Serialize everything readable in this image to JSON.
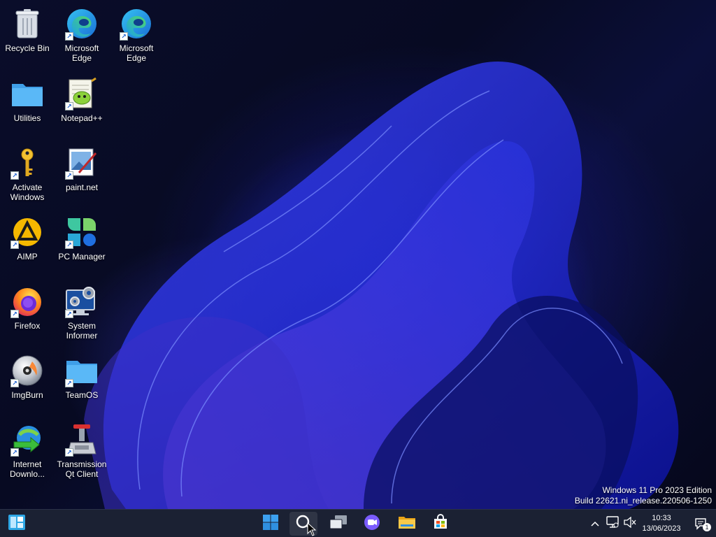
{
  "desktop": {
    "icons": [
      {
        "label": "Recycle Bin",
        "icon": "recycle-bin-icon"
      },
      {
        "label": "Microsoft Edge",
        "icon": "edge-icon"
      },
      {
        "label": "Microsoft Edge",
        "icon": "edge-icon"
      },
      {
        "label": "Utilities",
        "icon": "folder-icon"
      },
      {
        "label": "Notepad++",
        "icon": "notepad-plus-plus-icon"
      },
      {
        "label": "Activate Windows",
        "icon": "key-icon"
      },
      {
        "label": "paint.net",
        "icon": "paint-net-icon"
      },
      {
        "label": "AIMP",
        "icon": "aimp-icon"
      },
      {
        "label": "PC Manager",
        "icon": "pc-manager-icon"
      },
      {
        "label": "Firefox",
        "icon": "firefox-icon"
      },
      {
        "label": "System Informer",
        "icon": "system-informer-icon"
      },
      {
        "label": "ImgBurn",
        "icon": "imgburn-icon"
      },
      {
        "label": "TeamOS",
        "icon": "folder-icon"
      },
      {
        "label": "Internet Downlo...",
        "icon": "internet-download-manager-icon"
      },
      {
        "label": "Transmission Qt Client",
        "icon": "transmission-icon"
      }
    ]
  },
  "watermark": {
    "line1": "Windows 11 Pro 2023 Edition",
    "line2": "Build 22621.ni_release.220506-1250"
  },
  "taskbar": {
    "widgets_icon": "widgets-icon",
    "apps": [
      "start-icon",
      "search-icon",
      "task-view-icon",
      "chat-icon",
      "file-explorer-icon",
      "microsoft-store-icon"
    ],
    "tray": {
      "chevron": "chevron-up-icon",
      "network": "network-icon",
      "volume": "volume-muted-icon",
      "time": "10:33",
      "date": "13/06/2023",
      "notification_count": "1"
    }
  },
  "colors": {
    "taskbar_bg": "#1b2133",
    "accent": "#1a73e8",
    "folder": "#4fb3f5"
  }
}
